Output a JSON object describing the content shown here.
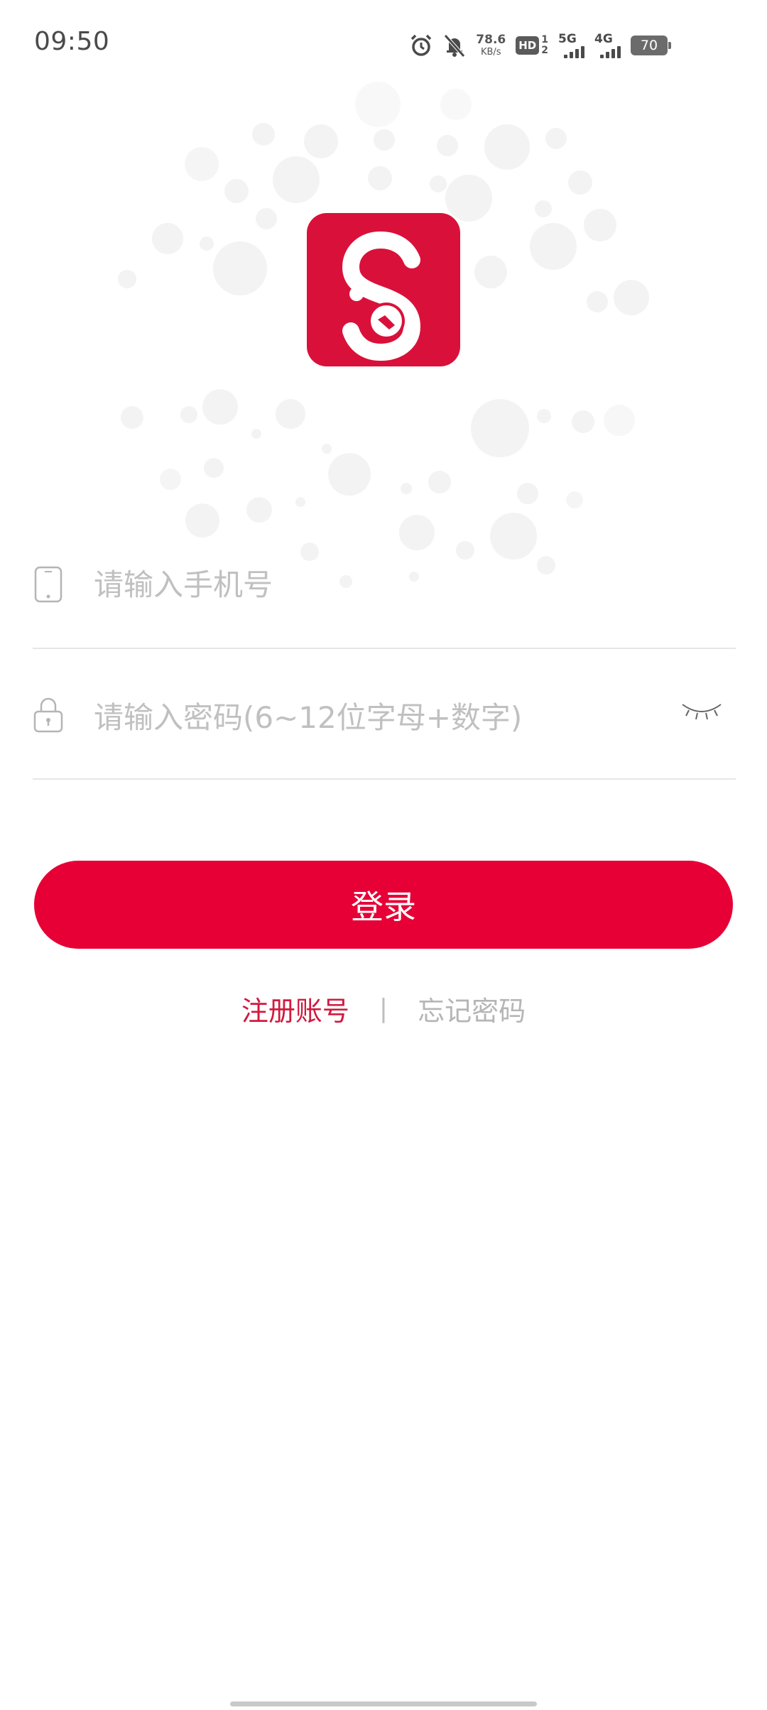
{
  "status_bar": {
    "time": "09:50",
    "net_speed_value": "78.6",
    "net_speed_unit": "KB/s",
    "hd_label": "HD",
    "hd_sub_top": "1",
    "hd_sub_bottom": "2",
    "signal1_label": "5G",
    "signal2_label": "4G",
    "battery": "70"
  },
  "brand": {
    "logo_color": "#d9113a"
  },
  "form": {
    "phone_placeholder": "请输入手机号",
    "password_placeholder": "请输入密码(6~12位字母+数字)"
  },
  "actions": {
    "login_label": "登录",
    "register_label": "注册账号",
    "separator": "|",
    "forgot_label": "忘记密码",
    "accent_color": "#e60036"
  }
}
